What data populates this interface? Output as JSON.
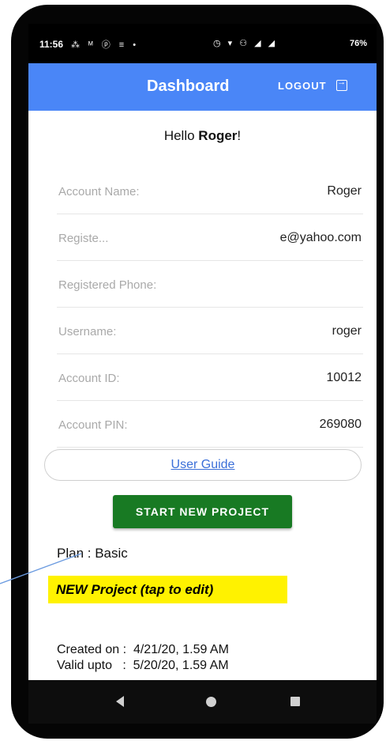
{
  "status_bar": {
    "time": "11:56",
    "left_icons": "⁂ ᴹ ⓟ ≡ •",
    "right_icons": "◷ ▾ ⚇ ◢ ◢",
    "battery": "76%"
  },
  "app_bar": {
    "title": "Dashboard",
    "logout_label": "LOGOUT"
  },
  "greeting": {
    "prefix": "Hello ",
    "name": "Roger",
    "suffix": "!"
  },
  "account_rows": [
    {
      "label": "Account Name:",
      "value": "Roger"
    },
    {
      "label": "Registe...",
      "value": "e@yahoo.com"
    },
    {
      "label": "Registered Phone:",
      "value": ""
    },
    {
      "label": "Username:",
      "value": "roger"
    },
    {
      "label": "Account ID:",
      "value": "10012"
    },
    {
      "label": "Account PIN:",
      "value": "269080"
    }
  ],
  "user_guide_label": "User Guide",
  "start_button_label": "START NEW PROJECT",
  "plan_text": "Plan : Basic",
  "new_project_label": "NEW Project (tap to edit)",
  "created_on": "Created on :  4/21/20, 1.59 AM",
  "valid_upto": "Valid upto   :  5/20/20, 1.59 AM",
  "colors": {
    "app_bar": "#4a86f7",
    "start_button": "#187a23",
    "highlight": "#fff200",
    "link": "#3b6fd8"
  }
}
